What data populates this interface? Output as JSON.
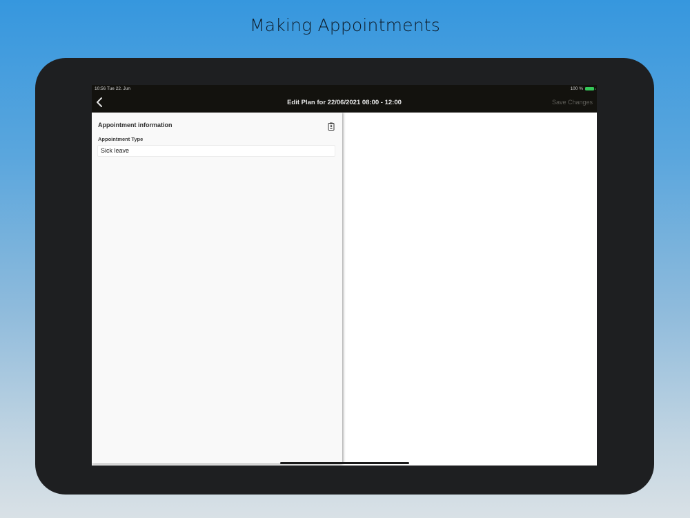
{
  "headline": "Making Appointments",
  "status_bar": {
    "time": "10:56  Tue 22. Jun",
    "battery": "100 %"
  },
  "nav": {
    "title": "Edit Plan for 22/06/2021 08:00 - 12:00",
    "save_label": "Save Changes",
    "back_icon": "chevron-left-icon"
  },
  "panel": {
    "header": "Appointment information",
    "header_icon": "clipboard-icon",
    "field_label": "Appointment Type",
    "field_value": "Sick leave"
  },
  "colors": {
    "nav_background": "#13120e",
    "panel_background": "#f9f9f9",
    "save_disabled": "#5e5d58",
    "battery": "#35c759"
  }
}
